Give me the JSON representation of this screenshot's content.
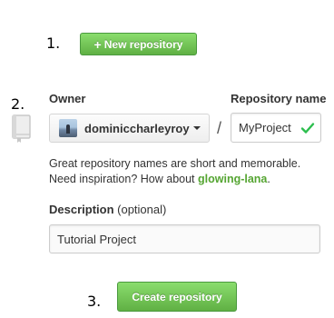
{
  "steps": {
    "step1": "1.",
    "step2": "2.",
    "step3": "3."
  },
  "new_repo_button": {
    "icon": "plus-icon",
    "plus": "+",
    "label": "New repository"
  },
  "owner": {
    "label": "Owner",
    "selected": "dominiccharleyroy",
    "avatar": "user-avatar"
  },
  "separator": "/",
  "repo_name": {
    "label": "Repository name",
    "value": "MyProject",
    "status_icon": "check-icon",
    "status_color": "#2cbe4e"
  },
  "help": {
    "line1": "Great repository names are short and memorable.",
    "line2_prefix": "Need inspiration? How about ",
    "suggestion": "glowing-lana",
    "line2_suffix": ".",
    "suggestion_color": "#55a532"
  },
  "description": {
    "label": "Description",
    "optional": "(optional)",
    "value": "Tutorial Project"
  },
  "create_button": {
    "label": "Create repository"
  },
  "colors": {
    "button_green": "#60b044",
    "text": "#333333"
  }
}
